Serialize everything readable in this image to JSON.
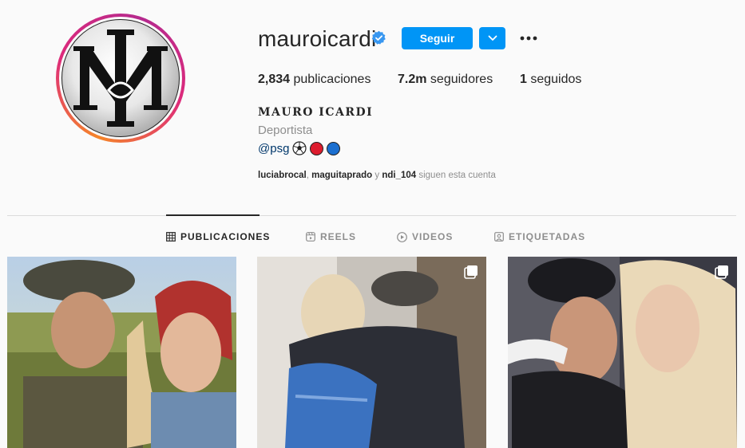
{
  "profile": {
    "username": "mauroicardi",
    "verified": true,
    "full_name": "MAURO ICARDI",
    "category": "Deportista",
    "bio_mention": "@psg",
    "bio_emojis": [
      "soccer-ball",
      "red-circle",
      "blue-circle"
    ],
    "avatar_logo": "MI"
  },
  "actions": {
    "follow_label": "Seguir"
  },
  "stats": [
    {
      "value": "2,834",
      "label": "publicaciones"
    },
    {
      "value": "7.2m",
      "label": "seguidores"
    },
    {
      "value": "1",
      "label": "seguidos"
    }
  ],
  "followed_by": {
    "users": [
      "luciabrocal",
      "maguitaprado",
      "ndi_104"
    ],
    "sep1": ",",
    "conj": "y",
    "suffix": "siguen esta cuenta"
  },
  "tabs": [
    {
      "label": "PUBLICACIONES",
      "icon": "grid-icon",
      "active": true
    },
    {
      "label": "REELS",
      "icon": "reels-icon",
      "active": false
    },
    {
      "label": "VIDEOS",
      "icon": "play-icon",
      "active": false
    },
    {
      "label": "ETIQUETADAS",
      "icon": "tag-user-icon",
      "active": false
    }
  ],
  "posts": [
    {
      "type": "photo",
      "multiple": false
    },
    {
      "type": "photo",
      "multiple": true
    },
    {
      "type": "photo",
      "multiple": true
    }
  ],
  "colors": {
    "accent": "#0095f6",
    "text": "#262626",
    "muted": "#8e8e8e",
    "background": "#fafafa",
    "mention": "#00376b"
  }
}
